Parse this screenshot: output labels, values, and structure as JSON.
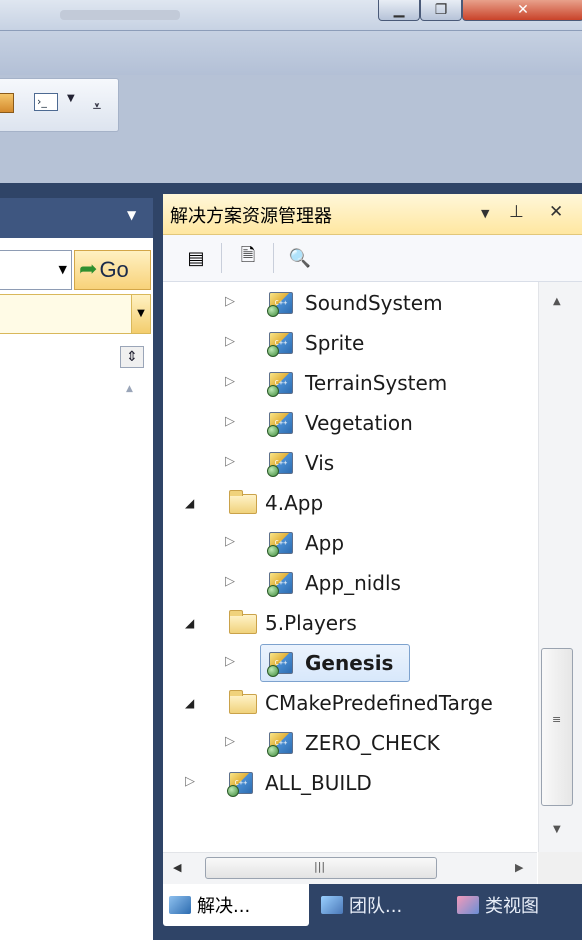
{
  "toolbar": {
    "go_label": "Go"
  },
  "solution_explorer": {
    "title": "解决方案资源管理器",
    "controls": {
      "dropdown": "▼",
      "pin": "ᵖ",
      "close": "✕"
    },
    "tree": [
      {
        "label": "SoundSystem",
        "type": "project",
        "level": 2,
        "expanded": false,
        "selected": false
      },
      {
        "label": "Sprite",
        "type": "project",
        "level": 2,
        "expanded": false,
        "selected": false
      },
      {
        "label": "TerrainSystem",
        "type": "project",
        "level": 2,
        "expanded": false,
        "selected": false
      },
      {
        "label": "Vegetation",
        "type": "project",
        "level": 2,
        "expanded": false,
        "selected": false
      },
      {
        "label": "Vis",
        "type": "project",
        "level": 2,
        "expanded": false,
        "selected": false
      },
      {
        "label": "4.App",
        "type": "folder",
        "level": 1,
        "expanded": true,
        "selected": false
      },
      {
        "label": "App",
        "type": "project",
        "level": 2,
        "expanded": false,
        "selected": false
      },
      {
        "label": "App_nidls",
        "type": "project",
        "level": 2,
        "expanded": false,
        "selected": false
      },
      {
        "label": "5.Players",
        "type": "folder",
        "level": 1,
        "expanded": true,
        "selected": false
      },
      {
        "label": "Genesis",
        "type": "project",
        "level": 2,
        "expanded": false,
        "selected": true
      },
      {
        "label": "CMakePredefinedTarge",
        "type": "folder",
        "level": 1,
        "expanded": true,
        "selected": false
      },
      {
        "label": "ZERO_CHECK",
        "type": "project",
        "level": 2,
        "expanded": false,
        "selected": false
      },
      {
        "label": "ALL_BUILD",
        "type": "project",
        "level": 1,
        "expanded": false,
        "selected": false
      }
    ],
    "tabs": [
      {
        "label": "解决...",
        "icon": "solution-explorer-icon",
        "active": true
      },
      {
        "label": "团队...",
        "icon": "team-explorer-icon",
        "active": false
      },
      {
        "label": "类视图",
        "icon": "class-view-icon",
        "active": false
      }
    ]
  },
  "colors": {
    "frame": "#2f4467",
    "title_highlight": "#ffe7a1",
    "selection": "#d8e8fb"
  }
}
